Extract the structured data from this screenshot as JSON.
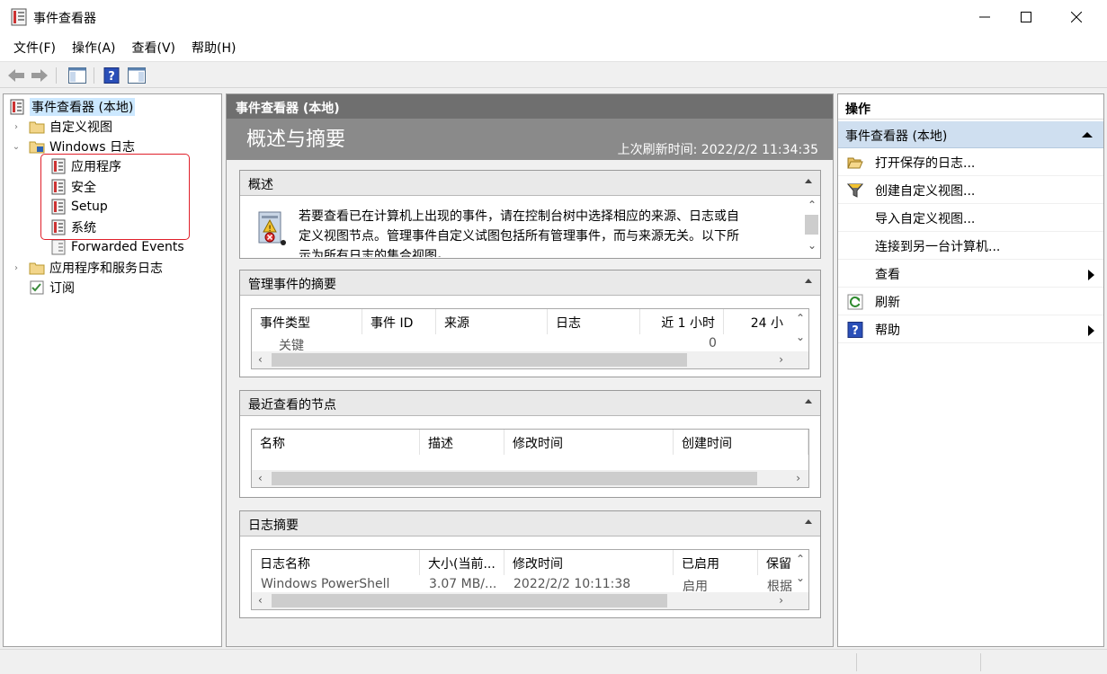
{
  "window": {
    "title": "事件查看器"
  },
  "menu": [
    "文件(F)",
    "操作(A)",
    "查看(V)",
    "帮助(H)"
  ],
  "tree": {
    "root": "事件查看器 (本地)",
    "custom_views": "自定义视图",
    "windows_logs": "Windows 日志",
    "logs": [
      "应用程序",
      "安全",
      "Setup",
      "系统",
      "Forwarded Events"
    ],
    "app_service_logs": "应用程序和服务日志",
    "subscriptions": "订阅"
  },
  "center": {
    "header": "事件查看器 (本地)",
    "overview_title": "概述与摘要",
    "last_refresh": "上次刷新时间: 2022/2/2 11:34:35",
    "overview_section": {
      "title": "概述",
      "text_line1": "若要查看已在计算机上出现的事件，请在控制台树中选择相应的来源、日志或自",
      "text_line2": "定义视图节点。管理事件自定义试图包括所有管理事件，而与来源无关。以下所",
      "text_line3": "示为所有日志的集合视图。"
    },
    "admin_section": {
      "title": "管理事件的摘要",
      "columns": [
        "事件类型",
        "事件 ID",
        "来源",
        "日志",
        "近 1 小时",
        "24 小"
      ],
      "partial_row": [
        "关键",
        "0"
      ]
    },
    "recent_section": {
      "title": "最近查看的节点",
      "columns": [
        "名称",
        "描述",
        "修改时间",
        "创建时间"
      ]
    },
    "log_section": {
      "title": "日志摘要",
      "columns": [
        "日志名称",
        "大小(当前...",
        "修改时间",
        "已启用",
        "保留"
      ],
      "partial_row": [
        "Windows PowerShell",
        "3.07 MB/...",
        "2022/2/2 10:11:38",
        "启用",
        "根据"
      ]
    }
  },
  "actions": {
    "header": "操作",
    "group": "事件查看器 (本地)",
    "items": [
      {
        "label": "打开保存的日志...",
        "icon": "folder-open-icon"
      },
      {
        "label": "创建自定义视图...",
        "icon": "filter-icon"
      },
      {
        "label": "导入自定义视图...",
        "icon": "none"
      },
      {
        "label": "连接到另一台计算机...",
        "icon": "none"
      },
      {
        "label": "查看",
        "icon": "none",
        "submenu": true
      },
      {
        "label": "刷新",
        "icon": "refresh-icon"
      },
      {
        "label": "帮助",
        "icon": "help-icon",
        "submenu": true
      }
    ]
  },
  "colors": {
    "selection": "#cce8ff",
    "highlight_border": "#e0202a",
    "action_group": "#cfdff0"
  }
}
